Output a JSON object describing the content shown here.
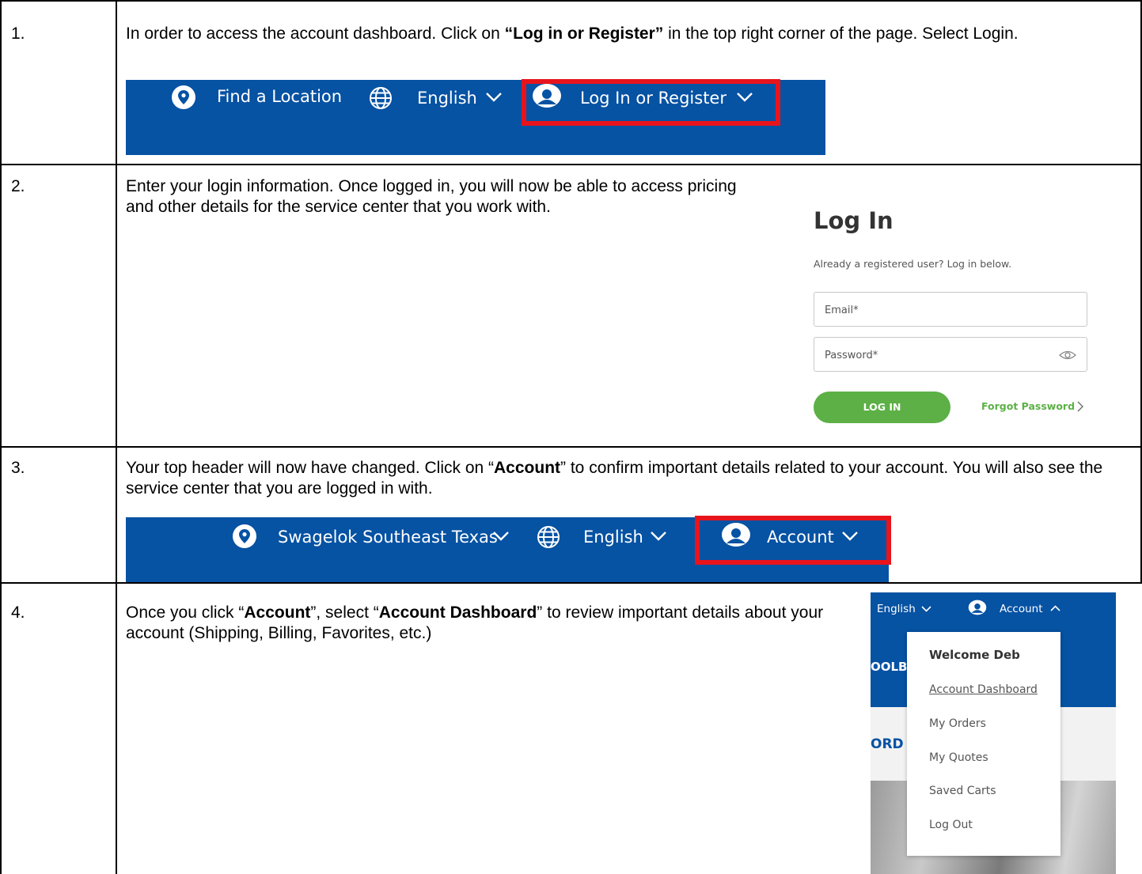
{
  "steps": [
    {
      "number": "1.",
      "text_parts": [
        "In order to access the account dashboard. Click on ",
        "“Log in or Register”",
        " in the top right corner of the page. Select Login."
      ],
      "nav": {
        "location": "Find a Location",
        "language": "English",
        "login": "Log In or Register"
      }
    },
    {
      "number": "2.",
      "text": "Enter your login information. Once logged in, you will now be able to access pricing and other details for the service center that you work with.",
      "login_form": {
        "title": "Log In",
        "subtitle": "Already a registered user? Log in below.",
        "email_placeholder": "Email*",
        "password_placeholder": "Password*",
        "login_button": "LOG IN",
        "forgot_link": "Forgot Password"
      }
    },
    {
      "number": "3.",
      "text_parts": [
        "Your top header will now have changed. Click on “",
        "Account",
        "” to confirm important details related to your account. You will also see the service center that you are logged in with."
      ],
      "nav": {
        "location": "Swagelok Southeast Texas",
        "language": "English",
        "account": "Account"
      }
    },
    {
      "number": "4.",
      "text_parts": [
        "Once you click “",
        "Account",
        "”, select “",
        "Account Dashboard",
        "” to review important details about your account (Shipping, Billing, Favorites, etc.)"
      ],
      "dropdown": {
        "language": "English",
        "account": "Account",
        "bg_text_1": "OOLB",
        "bg_text_2": "ORD",
        "welcome": "Welcome Deb",
        "items": [
          "Account Dashboard",
          "My Orders",
          "My Quotes",
          "Saved Carts",
          "Log Out"
        ]
      }
    }
  ],
  "colors": {
    "nav_blue": "#0652a3",
    "highlight_red": "#e8141c",
    "button_green": "#5cb046"
  }
}
